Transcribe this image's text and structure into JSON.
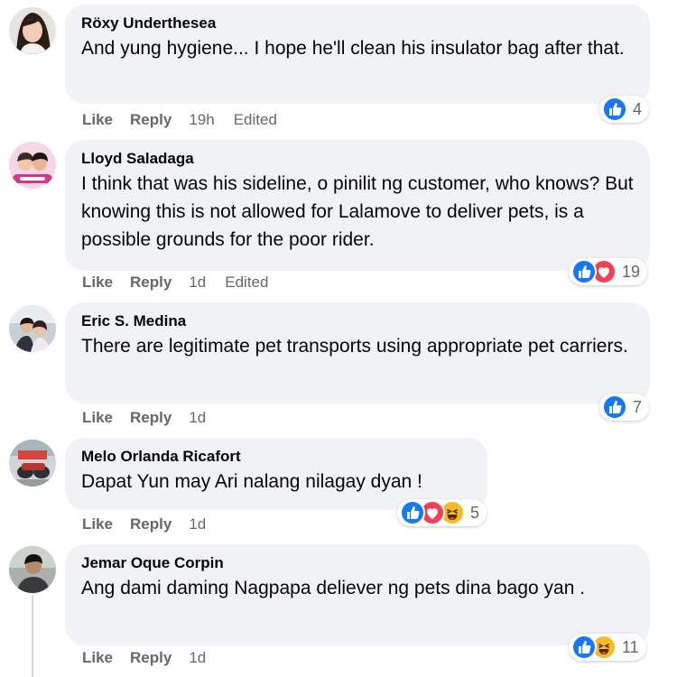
{
  "comments": [
    {
      "author": "Röxy Underthesea",
      "text": "And yung hygiene... I hope he'll clean his insulator bag after that.",
      "like": "Like",
      "reply": "Reply",
      "time": "19h",
      "edited": "Edited",
      "reaction_count": "4",
      "reactions": [
        "like-icon"
      ]
    },
    {
      "author": "Lloyd Saladaga",
      "text": "I think that was his sideline, o pinilit ng customer, who knows? But knowing this is not allowed for Lalamove to deliver pets, is a possible grounds for the poor rider.",
      "like": "Like",
      "reply": "Reply",
      "time": "1d",
      "edited": "Edited",
      "reaction_count": "19",
      "reactions": [
        "like-icon",
        "love-icon"
      ]
    },
    {
      "author": "Eric S. Medina",
      "text": "There are legitimate pet transports using appropriate pet carriers.",
      "like": "Like",
      "reply": "Reply",
      "time": "1d",
      "reaction_count": "7",
      "reactions": [
        "like-icon"
      ]
    },
    {
      "author": "Melo Orlanda Ricafort",
      "text": "Dapat Yun may Ari nalang nilagay dyan !",
      "like": "Like",
      "reply": "Reply",
      "time": "1d",
      "reaction_count": "5",
      "reactions": [
        "like-icon",
        "love-icon",
        "haha-icon"
      ]
    },
    {
      "author": "Jemar Oque Corpin",
      "text": "Ang dami daming Nagpapa deliever ng pets dina bago yan .",
      "like": "Like",
      "reply": "Reply",
      "time": "1d",
      "reaction_count": "11",
      "reactions": [
        "like-icon",
        "haha-icon"
      ]
    }
  ],
  "colors": {
    "bubble": "#f0f2f5",
    "text": "#050505",
    "meta": "#65676b",
    "like_blue": "#1877f2",
    "love_red": "#f33e58",
    "haha_yellow": "#f7b928"
  }
}
